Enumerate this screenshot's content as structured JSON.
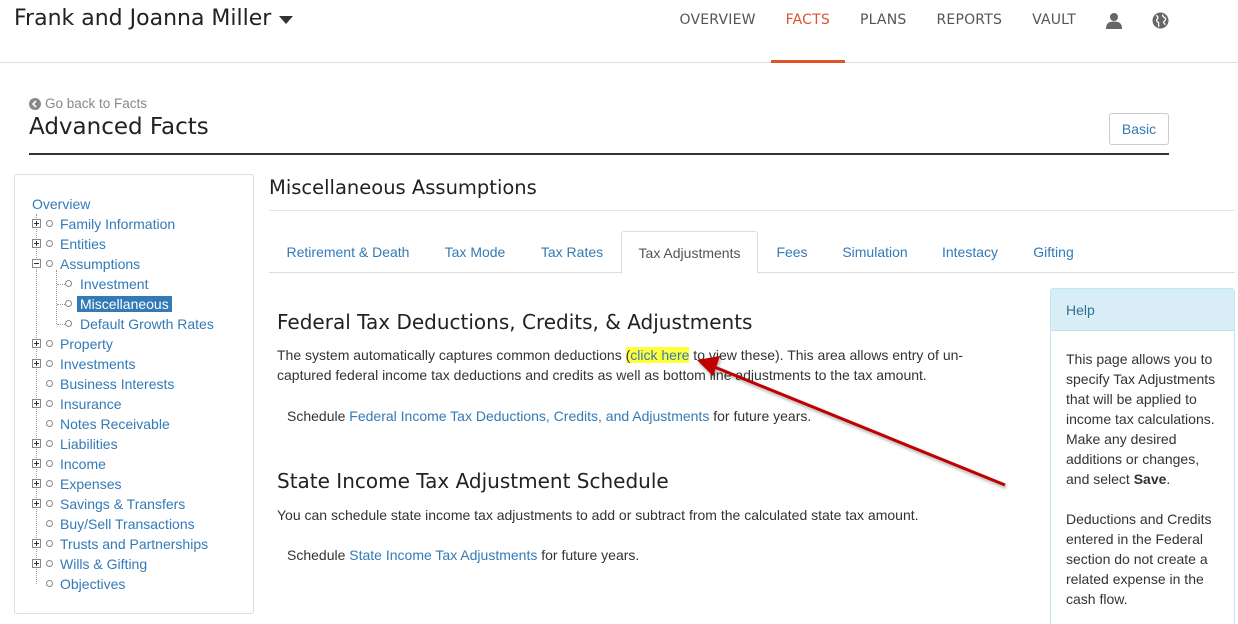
{
  "topbar": {
    "client_name": "Frank and Joanna Miller",
    "nav": [
      "OVERVIEW",
      "FACTS",
      "PLANS",
      "REPORTS",
      "VAULT"
    ],
    "active": "FACTS"
  },
  "header": {
    "back_label": "Go back to Facts",
    "title": "Advanced Facts",
    "basic_button": "Basic"
  },
  "tree": {
    "overview": "Overview",
    "items": [
      "Family Information",
      "Entities",
      "Assumptions",
      "Investment",
      "Miscellaneous",
      "Default Growth Rates",
      "Property",
      "Investments",
      "Business Interests",
      "Insurance",
      "Notes Receivable",
      "Liabilities",
      "Income",
      "Expenses",
      "Savings & Transfers",
      "Buy/Sell Transactions",
      "Trusts and Partnerships",
      "Wills & Gifting",
      "Objectives"
    ],
    "selected": "Miscellaneous"
  },
  "main": {
    "title": "Miscellaneous Assumptions",
    "tabs": [
      "Retirement & Death",
      "Tax Mode",
      "Tax Rates",
      "Tax Adjustments",
      "Fees",
      "Simulation",
      "Intestacy",
      "Gifting"
    ],
    "active_tab": "Tax Adjustments",
    "federal": {
      "heading": "Federal Tax Deductions, Credits, & Adjustments",
      "p_before": "The system automatically captures common deductions ",
      "paren_open": "(",
      "link": "click here",
      "p_after_1": " to view these). This area allows entry of un-",
      "p_after_2": "captured federal income tax deductions and credits as well as bottom line adjustments to the tax amount.",
      "sched_prefix": "Schedule ",
      "sched_link": "Federal Income Tax Deductions, Credits, and Adjustments",
      "sched_suffix": " for future years."
    },
    "state": {
      "heading": "State Income Tax Adjustment Schedule",
      "para": "You can schedule state income tax adjustments to add or subtract from the calculated state tax amount.",
      "sched_prefix": "Schedule ",
      "sched_link": "State Income Tax Adjustments",
      "sched_suffix": " for future years."
    }
  },
  "help": {
    "title": "Help",
    "p1_before": "This page allows you to specify Tax Adjustments that will be applied to income tax calculations. Make any desired additions or changes, and select ",
    "p1_bold": "Save",
    "p1_after": ".",
    "p2": "Deductions and Credits entered in the Federal section do not create a related expense in the cash flow."
  },
  "colors": {
    "accent": "#e0522c",
    "link": "#337ab7",
    "highlight": "#ffff3a",
    "annotation_arrow": "#c00000"
  }
}
